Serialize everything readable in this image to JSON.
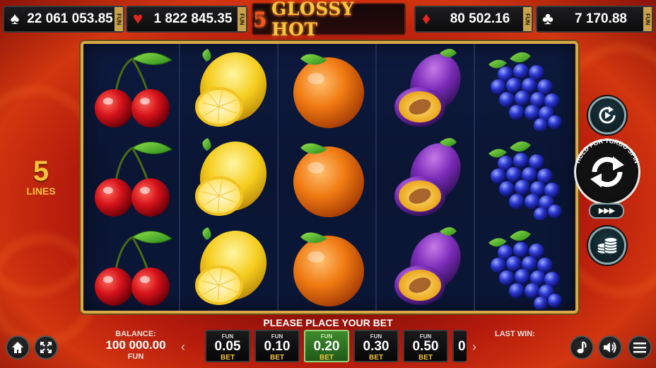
{
  "jackpots": [
    {
      "suit": "spade-icon",
      "glyph": "♠",
      "color": "#ffffff",
      "value": "22 061 053.85",
      "tag": "FUN"
    },
    {
      "suit": "heart-icon",
      "glyph": "♥",
      "color": "#e0281e",
      "value": "1 822 845.35",
      "tag": "FUN"
    },
    {
      "suit": "diamond-icon",
      "glyph": "♦",
      "color": "#e0281e",
      "value": "80 502.16",
      "tag": "FUN"
    },
    {
      "suit": "club-icon",
      "glyph": "♣",
      "color": "#ffffff",
      "value": "7 170.88",
      "tag": "FUN"
    }
  ],
  "logo": {
    "number": "5",
    "text": "GLOSSY HOT"
  },
  "lines": {
    "count": "5",
    "label": "LINES"
  },
  "reels": [
    "cherry",
    "lemon",
    "orange",
    "plum",
    "grapes"
  ],
  "controls": {
    "autoplay_icon": "autoplay-icon",
    "spin_hint": "HOLD FOR TURBO SPIN",
    "turbo": "▶▶▶",
    "bet_icon": "coins-icon"
  },
  "bottom": {
    "prompt": "PLEASE PLACE YOUR BET",
    "balance_title": "BALANCE:",
    "balance_value": "100 000.00",
    "balance_currency": "FUN",
    "last_win": "LAST WIN:",
    "bets": [
      {
        "fun": "FUN",
        "value": "0.05",
        "bet": "BET",
        "active": false
      },
      {
        "fun": "FUN",
        "value": "0.10",
        "bet": "BET",
        "active": false
      },
      {
        "fun": "FUN",
        "value": "0.20",
        "bet": "BET",
        "active": true
      },
      {
        "fun": "FUN",
        "value": "0.30",
        "bet": "BET",
        "active": false
      },
      {
        "fun": "FUN",
        "value": "0.50",
        "bet": "BET",
        "active": false
      }
    ],
    "partial_bet": "0",
    "arrow_left": "‹",
    "arrow_right": "›"
  },
  "colors": {
    "gold": "#d7a94a",
    "active_bet": "#3e8a2c"
  }
}
